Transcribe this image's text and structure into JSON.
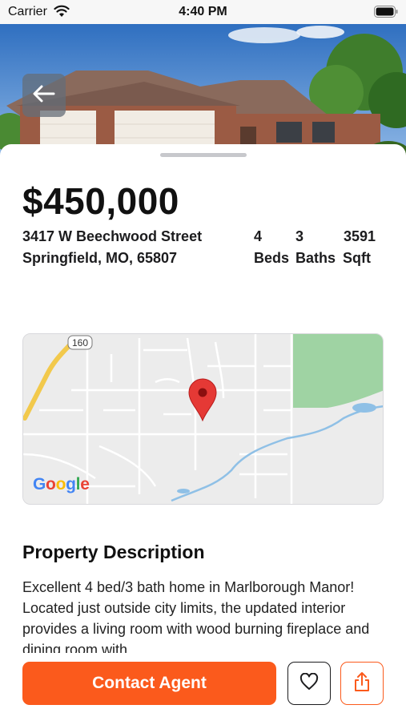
{
  "status_bar": {
    "carrier": "Carrier",
    "time": "4:40 PM"
  },
  "hero": {
    "image": "house-exterior-photo",
    "back_icon": "arrow-left-icon"
  },
  "listing": {
    "price": "$450,000",
    "address_line1": "3417 W Beechwood Street",
    "address_line2": "Springfield, MO, 65807",
    "stats": [
      {
        "value": "4",
        "label": "Beds"
      },
      {
        "value": "3",
        "label": "Baths"
      },
      {
        "value": "3591",
        "label": "Sqft"
      }
    ]
  },
  "map": {
    "route_badge": "160",
    "logo": "Google",
    "pin_color": "#e53935"
  },
  "description": {
    "title": "Property Description",
    "text": "Excellent 4 bed/3 bath home in Marlborough Manor! Located just outside city limits, the updated interior provides a living room with wood burning fireplace and dining room with"
  },
  "actions": {
    "contact_label": "Contact Agent",
    "favorite_icon": "heart-icon",
    "share_icon": "share-icon"
  },
  "colors": {
    "accent": "#fb5a1c",
    "text": "#1c1c1e"
  }
}
